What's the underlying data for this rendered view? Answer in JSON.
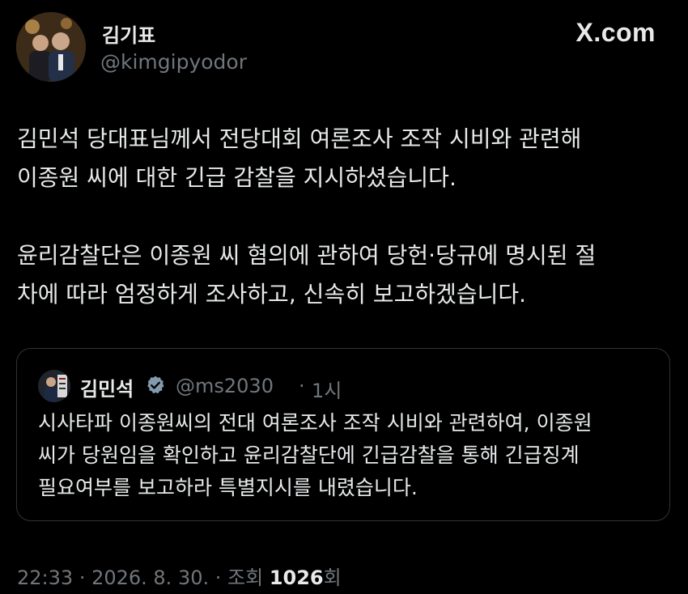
{
  "author": {
    "display_name": "김기표",
    "handle": "@kimgipyodor"
  },
  "brand": "X.com",
  "post": {
    "paragraphs": [
      [
        "김민석 당대표님께서 전당대회 여론조사 조작 시비와 관련해",
        "이종원 씨에 대한 긴급 감찰을 지시하셨습니다."
      ],
      [
        "윤리감찰단은 이종원 씨 혐의에 관하여 당헌·당규에 명시된 절",
        "차에 따라 엄정하게 조사하고, 신속히 보고하겠습니다."
      ]
    ]
  },
  "quote": {
    "display_name": "김민석",
    "verified_icon": "verified-badge-icon",
    "handle": "@ms2030",
    "separator": "·",
    "time": "1시",
    "lines": [
      "시사타파 이종원씨의 전대 여론조사 조작 시비와 관련하여, 이종원",
      "씨가 당원임을 확인하고 윤리감찰단에 긴급감찰을 통해 긴급징계",
      "필요여부를 보고하라 특별지시를 내렸습니다."
    ]
  },
  "meta": {
    "time": "22:33",
    "date": "2026. 8. 30.",
    "views_label": "조회",
    "views_count": "1026",
    "views_suffix": "회"
  },
  "colors": {
    "background": "#000000",
    "text": "#e7e9ea",
    "secondary": "#71767b",
    "border": "#2f3336",
    "verified": "#829aab"
  }
}
